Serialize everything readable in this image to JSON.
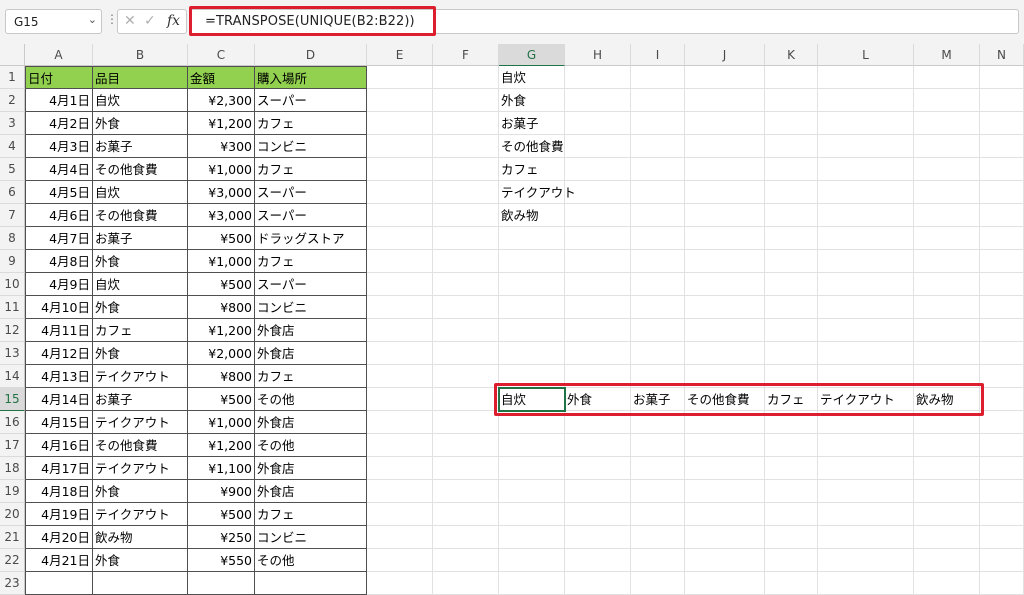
{
  "formula_bar": {
    "name_box": "G15",
    "formula": "=TRANSPOSE(UNIQUE(B2:B22))",
    "fx_label": "fx"
  },
  "columns": [
    "A",
    "B",
    "C",
    "D",
    "E",
    "F",
    "G",
    "H",
    "I",
    "J",
    "K",
    "L",
    "M",
    "N"
  ],
  "selected_column": "G",
  "selected_row": 15,
  "table": {
    "headers": [
      "日付",
      "品目",
      "金額",
      "購入場所"
    ],
    "rows": [
      [
        "4月1日",
        "自炊",
        "¥2,300",
        "スーパー"
      ],
      [
        "4月2日",
        "外食",
        "¥1,200",
        "カフェ"
      ],
      [
        "4月3日",
        "お菓子",
        "¥300",
        "コンビニ"
      ],
      [
        "4月4日",
        "その他食費",
        "¥1,000",
        "カフェ"
      ],
      [
        "4月5日",
        "自炊",
        "¥3,000",
        "スーパー"
      ],
      [
        "4月6日",
        "その他食費",
        "¥3,000",
        "スーパー"
      ],
      [
        "4月7日",
        "お菓子",
        "¥500",
        "ドラッグストア"
      ],
      [
        "4月8日",
        "外食",
        "¥1,000",
        "カフェ"
      ],
      [
        "4月9日",
        "自炊",
        "¥500",
        "スーパー"
      ],
      [
        "4月10日",
        "外食",
        "¥800",
        "コンビニ"
      ],
      [
        "4月11日",
        "カフェ",
        "¥1,200",
        "外食店"
      ],
      [
        "4月12日",
        "外食",
        "¥2,000",
        "外食店"
      ],
      [
        "4月13日",
        "テイクアウト",
        "¥800",
        "カフェ"
      ],
      [
        "4月14日",
        "お菓子",
        "¥500",
        "その他"
      ],
      [
        "4月15日",
        "テイクアウト",
        "¥1,000",
        "外食店"
      ],
      [
        "4月16日",
        "その他食費",
        "¥1,200",
        "その他"
      ],
      [
        "4月17日",
        "テイクアウト",
        "¥1,100",
        "外食店"
      ],
      [
        "4月18日",
        "外食",
        "¥900",
        "外食店"
      ],
      [
        "4月19日",
        "テイクアウト",
        "¥500",
        "カフェ"
      ],
      [
        "4月20日",
        "飲み物",
        "¥250",
        "コンビニ"
      ],
      [
        "4月21日",
        "外食",
        "¥550",
        "その他"
      ]
    ]
  },
  "unique_list": [
    "自炊",
    "外食",
    "お菓子",
    "その他食費",
    "カフェ",
    "テイクアウト",
    "飲み物"
  ],
  "transposed_row": [
    "自炊",
    "外食",
    "お菓子",
    "その他食費",
    "カフェ",
    "テイクアウト",
    "飲み物"
  ],
  "colors": {
    "header_fill": "#92d050",
    "highlight_red": "#dc1e2e",
    "selection_green": "#217346"
  }
}
